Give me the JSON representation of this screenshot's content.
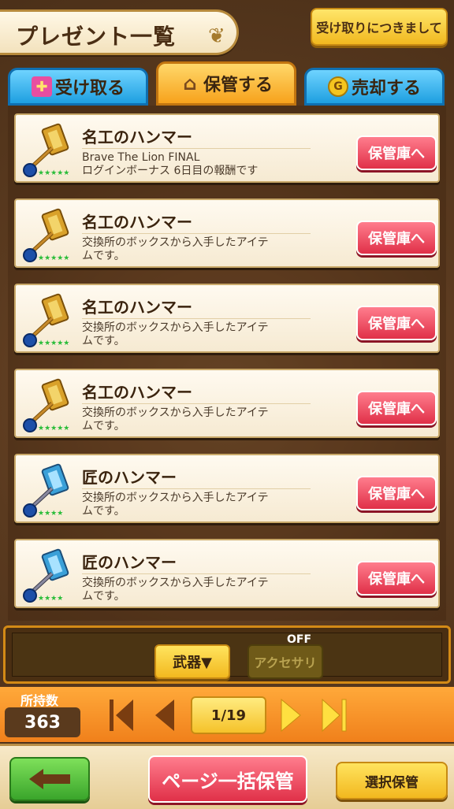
{
  "header": {
    "title": "プレゼント一覧",
    "about_button": "受け取りにつきまして"
  },
  "tabs": [
    {
      "label": "受け取る",
      "icon": "gift-icon",
      "active": false
    },
    {
      "label": "保管する",
      "icon": "house-icon",
      "active": true
    },
    {
      "label": "売却する",
      "icon": "coin-icon",
      "active": false
    }
  ],
  "items": [
    {
      "name": "名工のハンマー",
      "desc_line1": "Brave The Lion FINAL",
      "desc_line2": "ログインボーナス 6日目の報酬です",
      "button": "保管庫へ",
      "icon": "golden-hammer-icon",
      "stars": 5
    },
    {
      "name": "名工のハンマー",
      "desc_line1": "交換所のボックスから入手したアイテ",
      "desc_line2": "ムです。",
      "button": "保管庫へ",
      "icon": "golden-hammer-icon",
      "stars": 5
    },
    {
      "name": "名工のハンマー",
      "desc_line1": "交換所のボックスから入手したアイテ",
      "desc_line2": "ムです。",
      "button": "保管庫へ",
      "icon": "golden-hammer-icon",
      "stars": 5
    },
    {
      "name": "名工のハンマー",
      "desc_line1": "交換所のボックスから入手したアイテ",
      "desc_line2": "ムです。",
      "button": "保管庫へ",
      "icon": "golden-hammer-icon",
      "stars": 5
    },
    {
      "name": "匠のハンマー",
      "desc_line1": "交換所のボックスから入手したアイテ",
      "desc_line2": "ムです。",
      "button": "保管庫へ",
      "icon": "blue-hammer-icon",
      "stars": 4
    },
    {
      "name": "匠のハンマー",
      "desc_line1": "交換所のボックスから入手したアイテ",
      "desc_line2": "ムです。",
      "button": "保管庫へ",
      "icon": "blue-hammer-icon",
      "stars": 4
    }
  ],
  "filter": {
    "weapon_label": "武器▼",
    "accessory_label": "アクセサリ",
    "accessory_state": "OFF"
  },
  "pager": {
    "owned_label": "所持数",
    "owned_count": "363",
    "page": "1/19"
  },
  "bottom": {
    "bulk_label": "ページ一括保管",
    "select_label": "選択保管"
  },
  "colors": {
    "accent_red": "#e03048",
    "accent_yellow": "#f2b81f",
    "tab_blue": "#1e9fe0",
    "tab_orange": "#f7a21c",
    "wood_brown": "#5a3a20"
  }
}
